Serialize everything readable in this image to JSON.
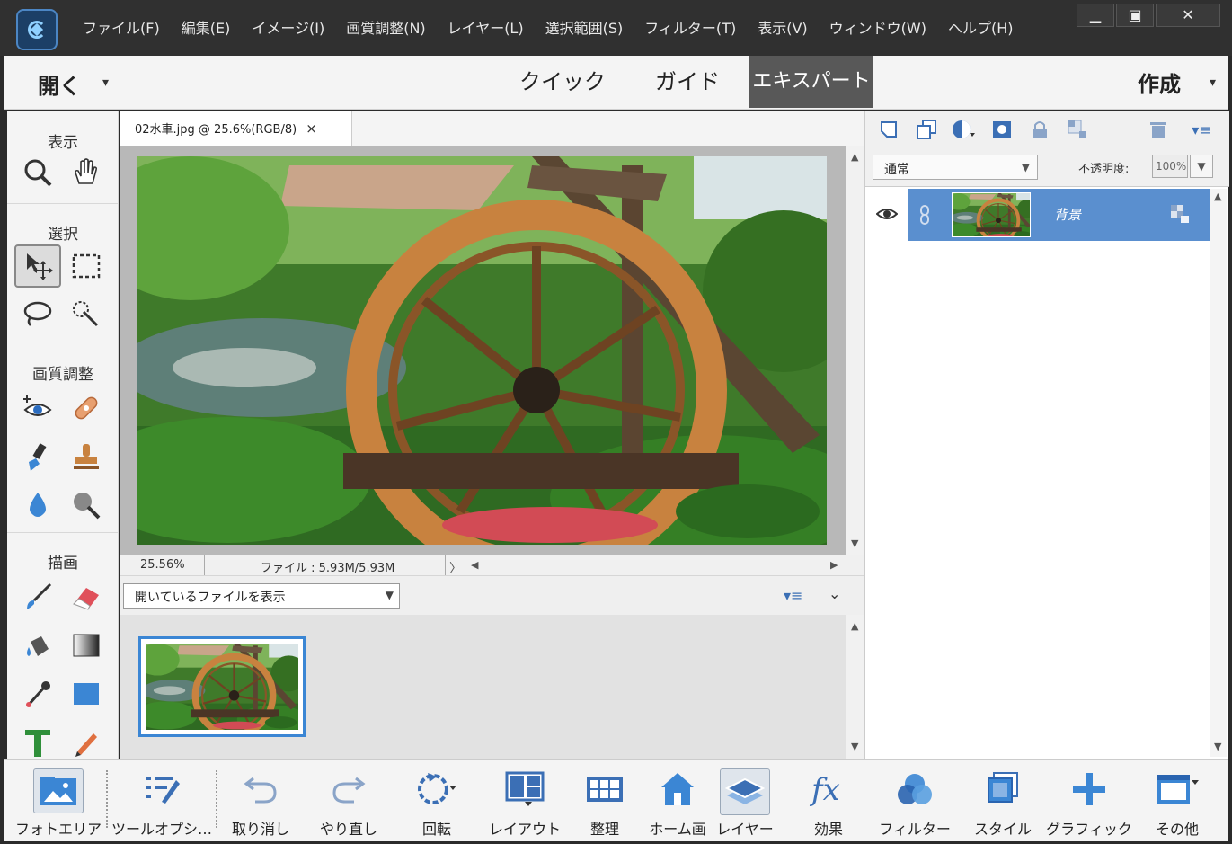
{
  "menubar": {
    "items": [
      "ファイル(F)",
      "編集(E)",
      "イメージ(I)",
      "画質調整(N)",
      "レイヤー(L)",
      "選択範囲(S)",
      "フィルター(T)",
      "表示(V)",
      "ウィンドウ(W)",
      "ヘルプ(H)"
    ]
  },
  "window_controls": {
    "minimize": "▁",
    "maximize": "▣",
    "close": "✕"
  },
  "modebar": {
    "open_label": "開く",
    "dropdown_glyph": "▾",
    "tabs": [
      "クイック",
      "ガイド",
      "エキスパート"
    ],
    "active_tab": "エキスパート",
    "create_label": "作成"
  },
  "toolbox": {
    "sections": [
      "表示",
      "選択",
      "画質調整",
      "描画"
    ]
  },
  "document": {
    "tab_title": "02水車.jpg @ 25.6%(RGB/8)",
    "close_glyph": "×",
    "zoom": "25.56%",
    "file_info": "ファイル : 5.93M/5.93M"
  },
  "photo_bin": {
    "selector_value": "開いているファイルを表示"
  },
  "layers": {
    "blend_mode": "通常",
    "opacity_label": "不透明度:",
    "opacity_value": "100%",
    "layer_name": "背景"
  },
  "taskbar": {
    "buttons": [
      "フォトエリア",
      "ツールオプシ…",
      "取り消し",
      "やり直し",
      "回転",
      "レイアウト",
      "整理",
      "ホーム画",
      "レイヤー",
      "効果",
      "フィルター",
      "スタイル",
      "グラフィック",
      "その他"
    ]
  },
  "colors": {
    "titlebar": "#303030",
    "panel_bg": "#f4f4f4",
    "accent_blue": "#3b86d4",
    "layer_selected": "#5a8fcf",
    "active_mode": "#585858"
  }
}
